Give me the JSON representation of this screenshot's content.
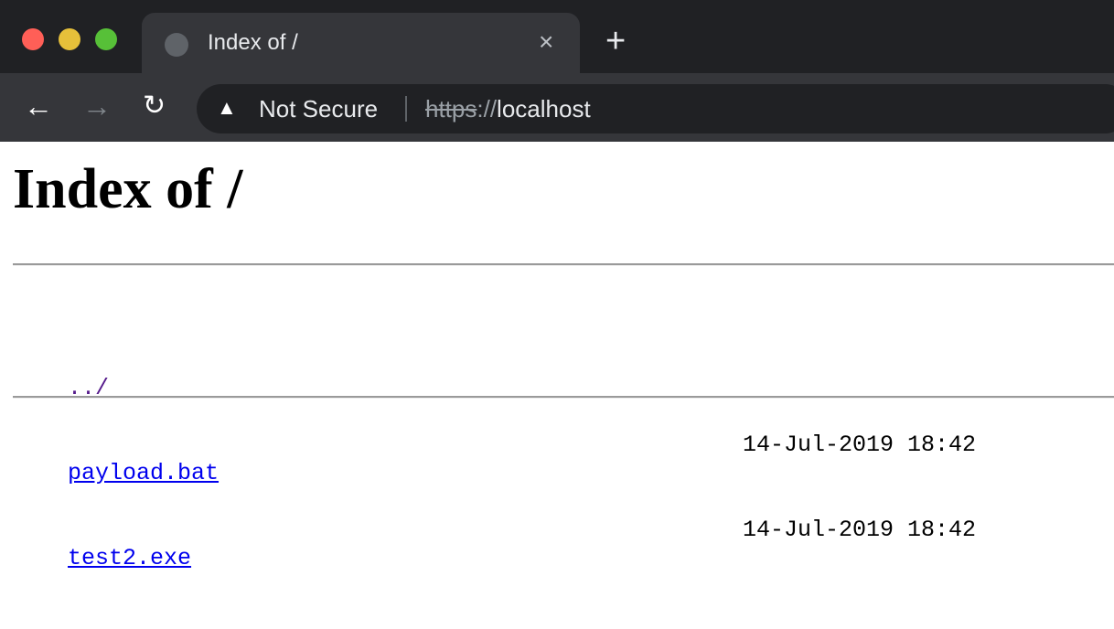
{
  "browser": {
    "tab": {
      "title": "Index of /",
      "icon": "globe-icon"
    },
    "new_tab_label": "+",
    "close_tab_label": "×",
    "address": {
      "security_label": "Not Secure",
      "url_scheme": "https",
      "url_separator": "://",
      "url_host": "localhost"
    },
    "colors": {
      "close": "#ff5f57",
      "minimize": "#e6c03a",
      "maximize": "#57c038"
    }
  },
  "page": {
    "heading": "Index of /",
    "entries": [
      {
        "name": "../",
        "date": ""
      },
      {
        "name": "payload.bat",
        "date": "14-Jul-2019 18:42"
      },
      {
        "name": "test2.exe",
        "date": "14-Jul-2019 18:42"
      }
    ]
  }
}
